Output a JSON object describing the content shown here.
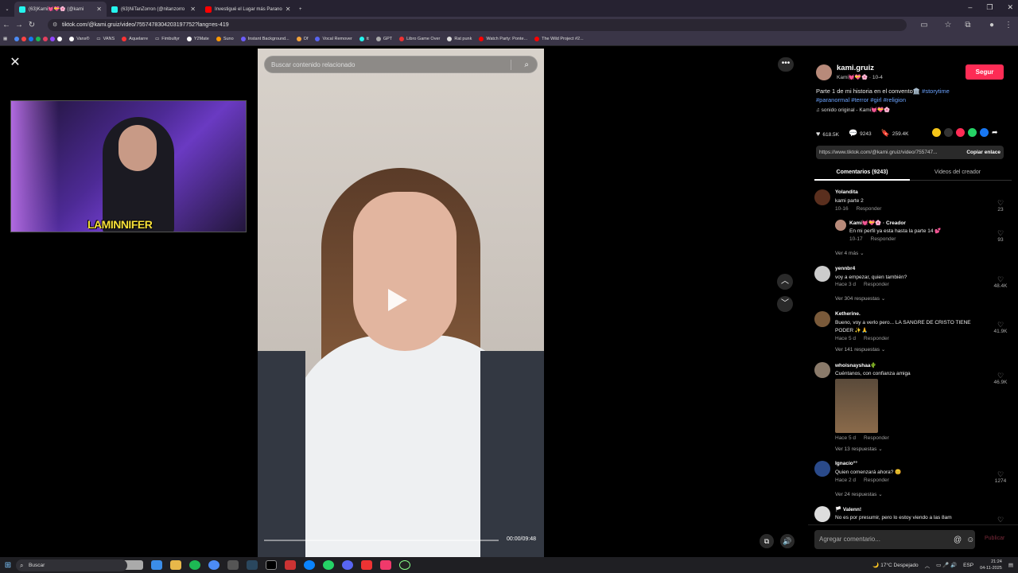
{
  "browser": {
    "tabs": [
      {
        "title": "(63)Kami💓💝🌸 (@kami",
        "active": true,
        "favicon_color": "#25f4ee"
      },
      {
        "title": "(63)NiTanZorron (@nitanzorro",
        "active": false,
        "favicon_color": "#25f4ee"
      },
      {
        "title": "Investigué el Lugar más Parano",
        "active": false,
        "favicon_color": "#ff0000"
      }
    ],
    "new_tab": "+",
    "window_controls": [
      "–",
      "❐",
      "✕"
    ],
    "url": "tiktok.com/@kami.gruiz/video/7557478304203197752?lang=es-419",
    "bookmarks": [
      "Vans®",
      "VANS",
      "Aquelarre",
      "Fimbultyr",
      "Y2Mate",
      "Suno",
      "Instant Background...",
      "Of",
      "Vocal Remover",
      "tt",
      "GPT",
      "Libro Game Over",
      "Rat punk",
      "Watch Party: Ponte...",
      "The Wild Project #2..."
    ]
  },
  "overlay": {
    "streamer_tag": "LAMINNIFER"
  },
  "video": {
    "search_placeholder": "Buscar contenido relacionado",
    "timecode": "00:00/09:48",
    "progress": 0.0
  },
  "panel": {
    "author": {
      "username": "kami.gruiz",
      "subline": "Kami💓💝🌸 · 10-4",
      "follow": "Segur"
    },
    "description": "Parte 1 de mi historia en el convento🏛️",
    "hashtags": [
      "#storytime",
      "#paranormal",
      "#terror",
      "#girl",
      "#religion"
    ],
    "sound": "♫  sonido original - Kami💓💝🌸",
    "stats": {
      "likes": "618.5K",
      "comments": "9243",
      "saves": "259.4K"
    },
    "link": "https://www.tiktok.com/@kami.gruiz/video/755747...",
    "copy_link": "Copiar enlace",
    "tab_comments": "Comentarios (9243)",
    "tab_videos": "Videos del creador",
    "comments": [
      {
        "name": "Yolandita",
        "text": "kami parte 2",
        "date": "10-16",
        "reply": "Responder",
        "likes": "23"
      },
      {
        "name": "Kami💓💝🌸 · Creador",
        "text": "En mi perfil ya esta hasta la parte 14 💕",
        "date": "10-17",
        "reply": "Responder",
        "likes": "93",
        "more": "Ver 4 más ⌄"
      },
      {
        "name": "yennbr4",
        "text": "voy a empezar, quien también?",
        "date": "Hace 3 d",
        "reply": "Responder",
        "likes": "48.4K",
        "more": "Ver 304 respuestas ⌄"
      },
      {
        "name": "Ketherine.",
        "text": "Bueno, voy a verlo pero... LA SANGRE DE CRISTO TIENE PODER ✨🙏",
        "date": "Hace 5 d",
        "reply": "Responder",
        "likes": "41.9K",
        "more": "Ver 141 respuestas ⌄"
      },
      {
        "name": "whoisnayshaa🌵",
        "text": "Cuéntanos, con confianza amiga",
        "date": "Hace 5 d",
        "reply": "Responder",
        "likes": "46.9K",
        "more": "Ver 13 respuestas ⌄"
      },
      {
        "name": "Ignacio°°",
        "text": "Quien comenzará ahora? 😊",
        "date": "Hace 2 d",
        "reply": "Responder",
        "likes": "1274",
        "more": "Ver 24 respuestas ⌄"
      },
      {
        "name": "🏳️ Valenn!",
        "text": "No es por presumir, pero lo estoy viendo a las 8am",
        "likes": ""
      }
    ],
    "comment_placeholder": "Agregar comentario...",
    "post": "Publicar"
  },
  "taskbar": {
    "search": "Buscar",
    "weather": "17°C  Despejado",
    "lang": "ESP",
    "time": "21:24",
    "date": "04-11-2025"
  }
}
